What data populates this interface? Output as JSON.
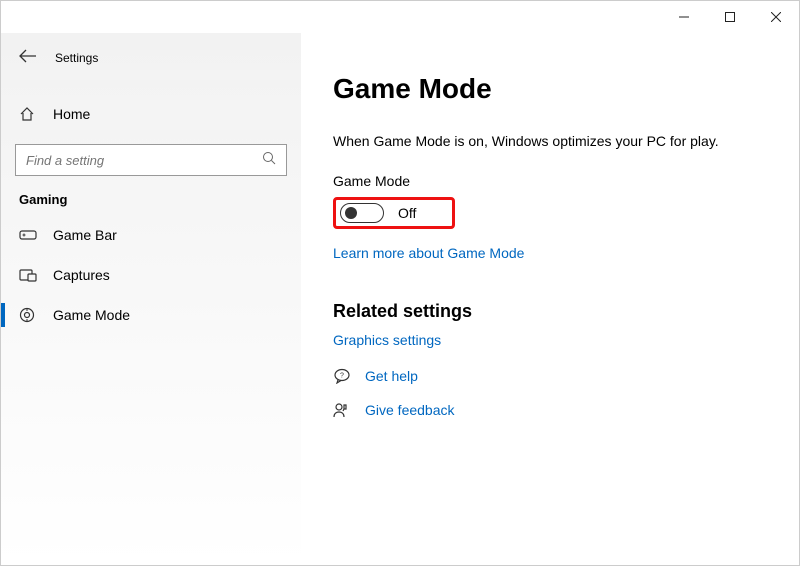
{
  "window_title": "Settings",
  "window_controls": {
    "minimize": "–",
    "maximize": "▢",
    "close": "✕"
  },
  "sidebar": {
    "home_label": "Home",
    "search_placeholder": "Find a setting",
    "section_label": "Gaming",
    "items": [
      {
        "label": "Game Bar",
        "icon": "gamebar-icon",
        "selected": false
      },
      {
        "label": "Captures",
        "icon": "captures-icon",
        "selected": false
      },
      {
        "label": "Game Mode",
        "icon": "gamemode-icon",
        "selected": true
      }
    ]
  },
  "main": {
    "heading": "Game Mode",
    "description": "When Game Mode is on, Windows optimizes your PC for play.",
    "toggle_label": "Game Mode",
    "toggle_state": "Off",
    "learn_more": "Learn more about Game Mode",
    "related_heading": "Related settings",
    "graphics_link": "Graphics settings",
    "get_help_label": "Get help",
    "give_feedback_label": "Give feedback"
  }
}
